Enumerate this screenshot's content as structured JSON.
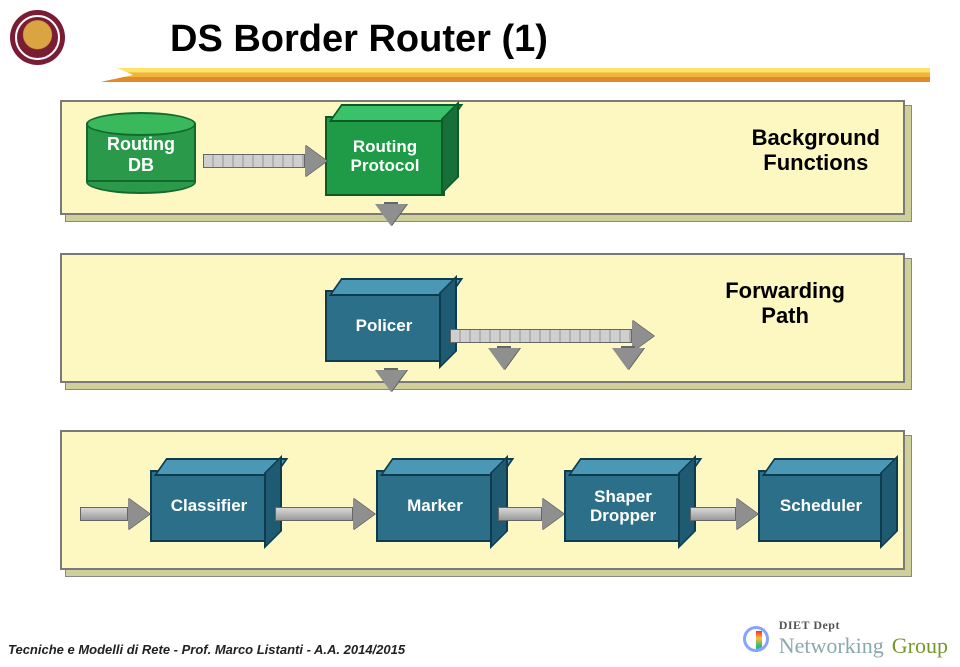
{
  "title": "DS Border Router (1)",
  "panel_top_label": "Background\nFunctions",
  "panel_mid_label": "Forwarding\nPath",
  "db": {
    "line1": "Routing",
    "line2": "DB"
  },
  "boxes": {
    "routing": {
      "line1": "Routing",
      "line2": "Protocol"
    },
    "policer": "Policer",
    "classifier": "Classifier",
    "marker": "Marker",
    "shaper": {
      "line1": "Shaper",
      "line2": "Dropper"
    },
    "scheduler": "Scheduler"
  },
  "footer": {
    "left": "Tecniche e Modelli di Rete - Prof. Marco Listanti  -  A.A. 2014/2015",
    "dept": "DIET Dept",
    "net": "Networking",
    "group": "Group"
  },
  "icons": {
    "logo": "institution-crest",
    "footer_orb": "network-globe"
  }
}
